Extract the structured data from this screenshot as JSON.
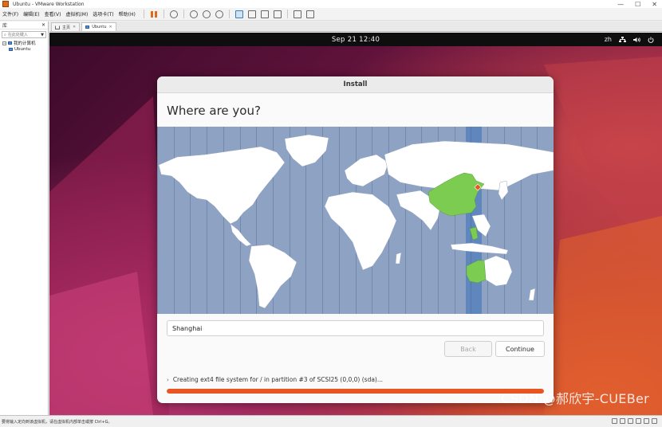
{
  "window": {
    "title": "Ubuntu - VMware Workstation",
    "minimize": "—",
    "maximize": "☐",
    "close": "✕"
  },
  "menu": [
    "文件(F)",
    "编辑(E)",
    "查看(V)",
    "虚拟机(M)",
    "选项卡(T)",
    "帮助(H)"
  ],
  "library": {
    "header": "库",
    "close": "✕",
    "search_placeholder": "在此处键入",
    "tree_root": "我的计算机",
    "tree_child": "Ubuntu"
  },
  "tabs": [
    {
      "label": "主页",
      "close": "✕"
    },
    {
      "label": "Ubuntu",
      "close": "✕"
    }
  ],
  "guest": {
    "clock": "Sep 21  12:40",
    "language": "zh",
    "network_icon": "network-icon",
    "volume_icon": "volume-icon",
    "power_icon": "power-icon"
  },
  "installer": {
    "header": "Install",
    "heading": "Where are you?",
    "timezone_value": "Shanghai",
    "back_label": "Back",
    "continue_label": "Continue",
    "status_text": "Creating ext4 file system for / in partition #3 of SCSI25 (0,0,0) (sda)...",
    "progress": 1.0,
    "accent_color": "#e95420",
    "highlight_color": "#7ccc52"
  },
  "watermark": "CSDN @郝欣宇-CUEBer",
  "statusbar_text": "要将输入定向到该虚拟机，请在虚拟机内部单击或按 Ctrl+G。"
}
